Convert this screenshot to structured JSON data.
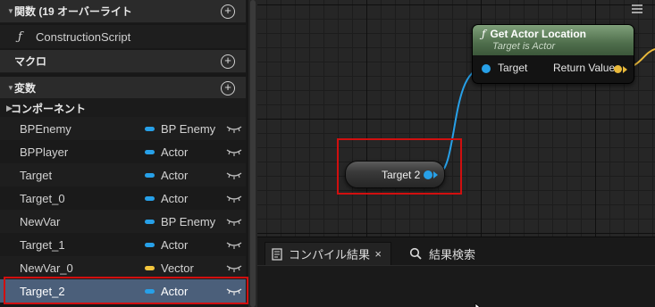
{
  "sections": {
    "functions": {
      "label": "関数 (19 オーバーライト",
      "collapse_glyph": "▼"
    },
    "macros": {
      "label": "マクロ"
    },
    "variables": {
      "label": "変数",
      "collapse_glyph": "▼"
    },
    "components": {
      "label": "コンポーネント",
      "expand_glyph": "▶"
    }
  },
  "add_glyph": "+",
  "construction_script": {
    "icon_glyph": "ƒ",
    "label": "ConstructionScript"
  },
  "variables": [
    {
      "name": "BPEnemy",
      "type": "BP Enemy",
      "pin_color": "#27a0e8"
    },
    {
      "name": "BPPlayer",
      "type": "Actor",
      "pin_color": "#27a0e8"
    },
    {
      "name": "Target",
      "type": "Actor",
      "pin_color": "#27a0e8"
    },
    {
      "name": "Target_0",
      "type": "Actor",
      "pin_color": "#27a0e8"
    },
    {
      "name": "NewVar",
      "type": "BP Enemy",
      "pin_color": "#27a0e8"
    },
    {
      "name": "Target_1",
      "type": "Actor",
      "pin_color": "#27a0e8"
    },
    {
      "name": "NewVar_0",
      "type": "Vector",
      "pin_color": "#f2c53d"
    },
    {
      "name": "Target_2",
      "type": "Actor",
      "pin_color": "#27a0e8",
      "selected": true
    }
  ],
  "graph": {
    "get_actor_location": {
      "icon_glyph": "ƒ",
      "title": "Get Actor Location",
      "subtitle": "Target is Actor",
      "input_pin": "Target",
      "output_pin": "Return Value"
    },
    "get_node": {
      "label": "Target 2"
    }
  },
  "dock": {
    "compile_tab": {
      "label": "コンパイル結果",
      "close_glyph": "×"
    },
    "search_tab": {
      "label": "結果検索"
    }
  },
  "colors": {
    "object_pin": "#27a0e8",
    "vector_pin": "#e8b83a",
    "highlight_box": "#d10f0f",
    "selected_row": "#4b5f7a",
    "function_header": "#5f805c"
  }
}
